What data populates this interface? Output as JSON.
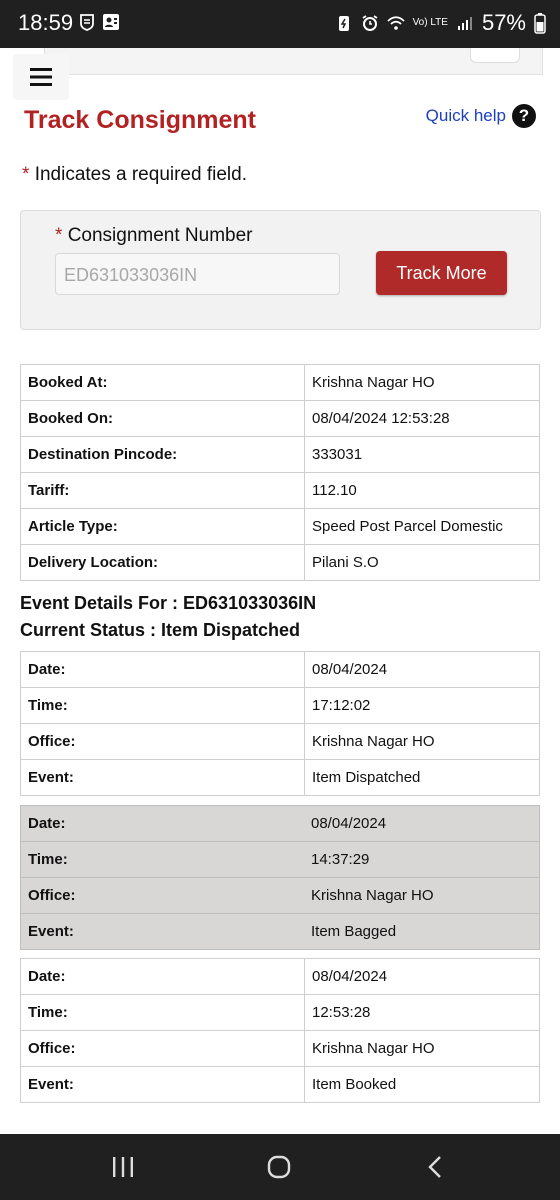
{
  "status_bar": {
    "time": "18:59",
    "battery": "57%",
    "network_label": "Vo) LTE"
  },
  "header": {
    "title": "Track Consignment",
    "quick_help": "Quick help",
    "quick_help_icon": "?"
  },
  "form": {
    "required_star": "*",
    "required_note": "Indicates a required field.",
    "consignment_label": "Consignment Number",
    "consignment_value": "ED631033036IN",
    "track_button": "Track More"
  },
  "booking": [
    {
      "label": "Booked At:",
      "value": "Krishna Nagar HO"
    },
    {
      "label": "Booked On:",
      "value": "08/04/2024 12:53:28"
    },
    {
      "label": "Destination Pincode:",
      "value": "333031"
    },
    {
      "label": "Tariff:",
      "value": "112.10"
    },
    {
      "label": "Article Type:",
      "value": "Speed Post Parcel Domestic"
    },
    {
      "label": "Delivery Location:",
      "value": "Pilani S.O"
    }
  ],
  "event_heading": "Event Details For : ED631033036IN",
  "status_heading": "Current Status : Item Dispatched",
  "events": [
    {
      "date_label": "Date:",
      "date": "08/04/2024",
      "time_label": "Time:",
      "time": "17:12:02",
      "office_label": "Office:",
      "office": "Krishna Nagar HO",
      "event_label": "Event:",
      "event": "Item Dispatched"
    },
    {
      "date_label": "Date:",
      "date": "08/04/2024",
      "time_label": "Time:",
      "time": "14:37:29",
      "office_label": "Office:",
      "office": "Krishna Nagar HO",
      "event_label": "Event:",
      "event": "Item Bagged"
    },
    {
      "date_label": "Date:",
      "date": "08/04/2024",
      "time_label": "Time:",
      "time": "12:53:28",
      "office_label": "Office:",
      "office": "Krishna Nagar HO",
      "event_label": "Event:",
      "event": "Item Booked"
    }
  ]
}
